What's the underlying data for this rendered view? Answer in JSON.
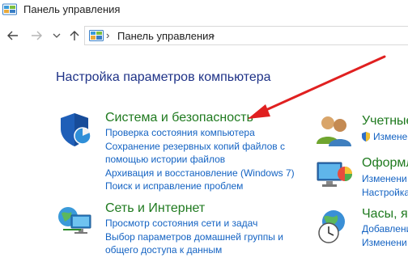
{
  "window": {
    "title": "Панель управления"
  },
  "address_bar": {
    "path": "Панель управления",
    "separator": "›"
  },
  "main": {
    "heading": "Настройка параметров компьютера",
    "categories": [
      {
        "title": "Система и безопасность",
        "links": [
          "Проверка состояния компьютера",
          "Сохранение резервных копий файлов с",
          "помощью истории файлов",
          "Архивация и восстановление (Windows 7)",
          "Поиск и исправление проблем"
        ]
      },
      {
        "title": "Сеть и Интернет",
        "links": [
          "Просмотр состояния сети и задач",
          "Выбор параметров домашней группы и",
          "общего доступа к данным"
        ]
      },
      {
        "title": "Учетные",
        "links": [
          "Измене"
        ]
      },
      {
        "title": "Оформл",
        "links": [
          "Изменени",
          "Настройка"
        ]
      },
      {
        "title": "Часы, яз",
        "links": [
          "Добавлени",
          "Изменени"
        ]
      }
    ]
  },
  "colors": {
    "category_title": "#1f7a1f",
    "link": "#1463c3",
    "heading": "#1e3287",
    "arrow": "#e02020"
  },
  "icons": [
    "control-panel-icon",
    "back-arrow-icon",
    "forward-arrow-icon",
    "chevron-down-icon",
    "up-arrow-icon",
    "shield-icon",
    "network-icon",
    "users-icon",
    "uac-shield-icon",
    "appearance-icon",
    "clock-globe-icon"
  ]
}
